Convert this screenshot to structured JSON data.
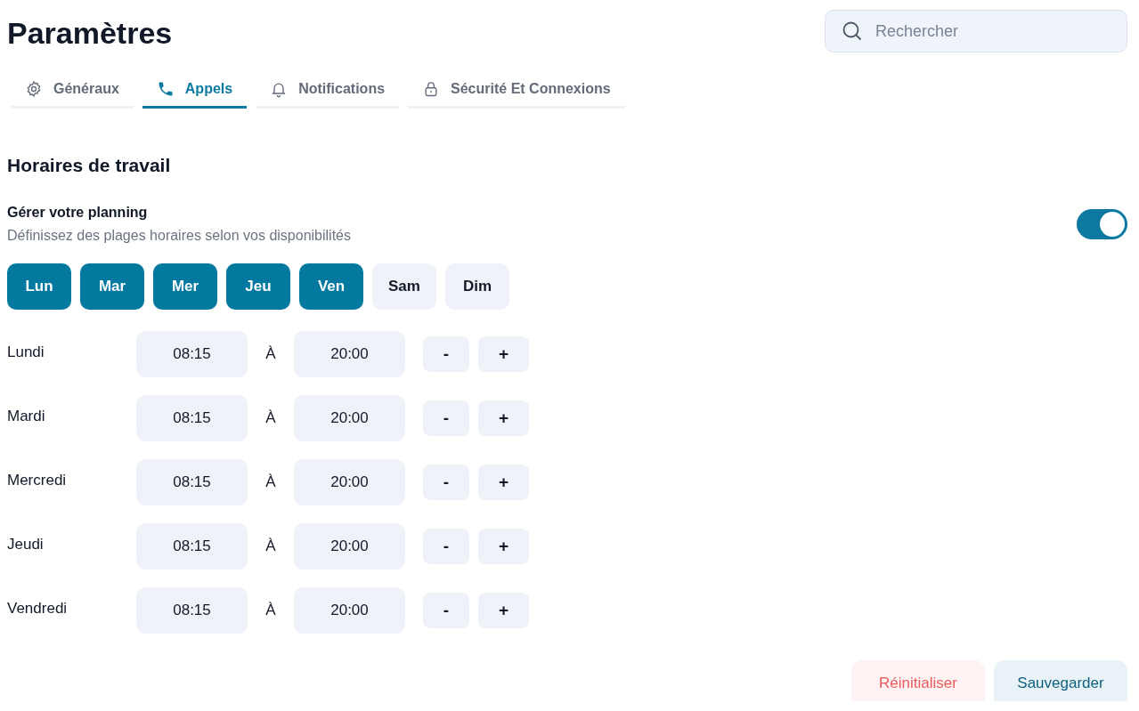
{
  "title": "Paramètres",
  "search": {
    "placeholder": "Rechercher"
  },
  "tabs": [
    {
      "label": "Généraux",
      "kind": "gear",
      "selected": false
    },
    {
      "label": "Appels",
      "kind": "phone",
      "selected": true
    },
    {
      "label": "Notifications",
      "kind": "bell",
      "selected": false
    },
    {
      "label": "Sécurité Et Connexions",
      "kind": "lock",
      "selected": false
    }
  ],
  "section_title": "Horaires de travail",
  "planning": {
    "label": "Gérer votre planning",
    "description": "Définissez des plages horaires selon vos disponibilités",
    "on": true
  },
  "days": [
    {
      "label": "Lun",
      "selected": true
    },
    {
      "label": "Mar",
      "selected": true
    },
    {
      "label": "Mer",
      "selected": true
    },
    {
      "label": "Jeu",
      "selected": true
    },
    {
      "label": "Ven",
      "selected": true
    },
    {
      "label": "Sam",
      "selected": false
    },
    {
      "label": "Dim",
      "selected": false
    }
  ],
  "schedule": [
    {
      "day": "Lundi",
      "start": "08:15",
      "separator": "À",
      "end": "20:00",
      "minus": "-",
      "plus": "+"
    },
    {
      "day": "Mardi",
      "start": "08:15",
      "separator": "À",
      "end": "20:00",
      "minus": "-",
      "plus": "+"
    },
    {
      "day": "Mercredi",
      "start": "08:15",
      "separator": "À",
      "end": "20:00",
      "minus": "-",
      "plus": "+"
    },
    {
      "day": "Jeudi",
      "start": "08:15",
      "separator": "À",
      "end": "20:00",
      "minus": "-",
      "plus": "+"
    },
    {
      "day": "Vendredi",
      "start": "08:15",
      "separator": "À",
      "end": "20:00",
      "minus": "-",
      "plus": "+"
    }
  ],
  "buttons": [
    {
      "label": "Réinitialiser",
      "kind": "reset"
    },
    {
      "label": "Sauvegarder",
      "kind": "save"
    }
  ]
}
